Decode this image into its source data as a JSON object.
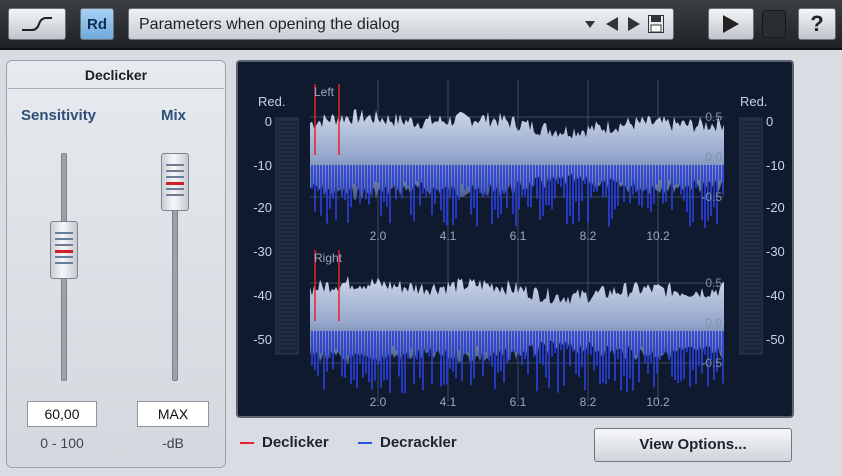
{
  "toolbar": {
    "curve_icon": "curve-icon",
    "rd_label": "Rd",
    "preset_text": "Parameters when opening the dialog",
    "help_label": "?"
  },
  "declicker": {
    "title": "Declicker",
    "sensitivity": {
      "label": "Sensitivity",
      "value": "60,00",
      "range": "0 - 100",
      "level": 0.6
    },
    "mix": {
      "label": "Mix",
      "value": "MAX",
      "unit": "-dB",
      "level": 1.0
    }
  },
  "display": {
    "left_scale_title": "Red.",
    "right_scale_title": "Red.",
    "db_ticks": [
      "0",
      "-10",
      "-20",
      "-30",
      "-40",
      "-50"
    ],
    "right_db_ticks": [
      "0",
      "-10",
      "-20",
      "-30",
      "-40",
      "-50"
    ],
    "left_channel_label": "Left",
    "right_channel_label": "Right",
    "time_ticks": [
      "2.0",
      "4.1",
      "6.1",
      "8.2",
      "10.2"
    ],
    "amp_ticks": [
      "0.5",
      "0.0",
      "-0.5"
    ],
    "colors": {
      "background": "#101a2e",
      "waveform": "#b8c6e0",
      "decrackler": "#2a3fd8",
      "declicker": "#e8202a"
    }
  },
  "legend": {
    "declicker_label": "Declicker",
    "decrackler_label": "Decrackler",
    "declicker_color": "#e8202a",
    "decrackler_color": "#2a53e0"
  },
  "view_options_label": "View Options..."
}
